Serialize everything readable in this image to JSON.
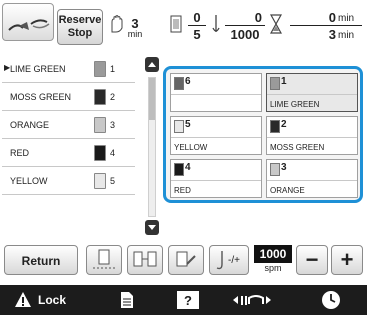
{
  "header": {
    "reserve_label_1": "Reserve",
    "reserve_label_2": "Stop",
    "speed_value": "3",
    "speed_unit": "min",
    "color_done": "0",
    "color_total": "5",
    "stitch_done": "0",
    "stitch_total": "1000",
    "time_done": "0",
    "time_done_unit": "min",
    "time_total": "3",
    "time_total_unit": "min"
  },
  "thread_list": [
    {
      "name": "LIME GREEN",
      "number": "1",
      "active": true
    },
    {
      "name": "MOSS GREEN",
      "number": "2",
      "active": false
    },
    {
      "name": "ORANGE",
      "number": "3",
      "active": false
    },
    {
      "name": "RED",
      "number": "4",
      "active": false
    },
    {
      "name": "YELLOW",
      "number": "5",
      "active": false
    }
  ],
  "spool_grid": [
    {
      "number": "6",
      "name": ""
    },
    {
      "number": "1",
      "name": "LIME GREEN"
    },
    {
      "number": "5",
      "name": "YELLOW"
    },
    {
      "number": "2",
      "name": "MOSS GREEN"
    },
    {
      "number": "4",
      "name": "RED"
    },
    {
      "number": "3",
      "name": "ORANGE"
    }
  ],
  "toolbar": {
    "return_label": "Return",
    "tension_label": "-/+",
    "speed_value": "1000",
    "speed_unit": "spm",
    "minus_label": "−",
    "plus_label": "+"
  },
  "bottom_bar": {
    "lock_label": "Lock"
  },
  "colors": {
    "accent": "#1e90d6",
    "bottom_bar": "#1c1c1c",
    "spool_colors": {
      "LIME GREEN": "#9a9a9a",
      "MOSS GREEN": "#2a2a2a",
      "ORANGE": "#c8c8c8",
      "RED": "#1a1a1a",
      "YELLOW": "#e8e8e8"
    }
  }
}
